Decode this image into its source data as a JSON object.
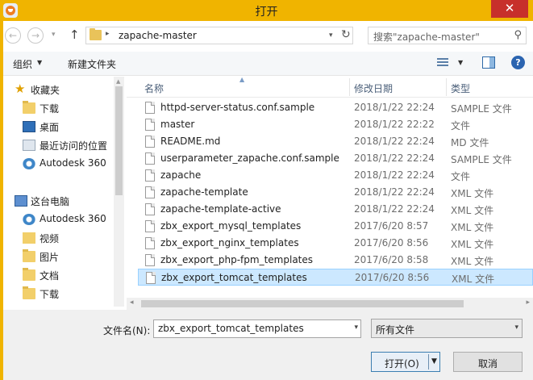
{
  "window": {
    "title": "打开",
    "close_glyph": "✕"
  },
  "nav": {
    "back_glyph": "←",
    "forward_glyph": "→",
    "recent_glyph": "▾",
    "up_glyph": "↑",
    "address": "zapache-master",
    "address_sep": "▸",
    "address_dd": "▾",
    "refresh_glyph": "↻",
    "search_placeholder": "搜索\"zapache-master\"",
    "search_glyph": "⚲"
  },
  "toolbar": {
    "organize": "组织",
    "organize_arrow": "▼",
    "new_folder": "新建文件夹",
    "view_arrow": "▼",
    "help": "?"
  },
  "sidebar": {
    "items": [
      {
        "label": "收藏夹",
        "icon": "star-icon"
      },
      {
        "label": "下载",
        "icon": "folder-icon"
      },
      {
        "label": "桌面",
        "icon": "desktop-icon"
      },
      {
        "label": "最近访问的位置",
        "icon": "recent-places-icon"
      },
      {
        "label": "Autodesk 360",
        "icon": "cloud-icon"
      },
      {
        "label": "这台电脑",
        "icon": "computer-icon"
      },
      {
        "label": "Autodesk 360",
        "icon": "cloud-icon"
      },
      {
        "label": "视频",
        "icon": "video-folder-icon"
      },
      {
        "label": "图片",
        "icon": "pictures-folder-icon"
      },
      {
        "label": "文档",
        "icon": "documents-folder-icon"
      },
      {
        "label": "下载",
        "icon": "downloads-folder-icon"
      }
    ],
    "scroll_up": "▲"
  },
  "filelist": {
    "columns": {
      "name": "名称",
      "modified": "修改日期",
      "type": "类型"
    },
    "sort_glyph": "▲",
    "rows": [
      {
        "name": "httpd-server-status.conf.sample",
        "date": "2018/1/22 22:24",
        "type": "SAMPLE 文件"
      },
      {
        "name": "master",
        "date": "2018/1/22 22:22",
        "type": "文件"
      },
      {
        "name": "README.md",
        "date": "2018/1/22 22:24",
        "type": "MD 文件"
      },
      {
        "name": "userparameter_zapache.conf.sample",
        "date": "2018/1/22 22:24",
        "type": "SAMPLE 文件"
      },
      {
        "name": "zapache",
        "date": "2018/1/22 22:24",
        "type": "文件"
      },
      {
        "name": "zapache-template",
        "date": "2018/1/22 22:24",
        "type": "XML 文件"
      },
      {
        "name": "zapache-template-active",
        "date": "2018/1/22 22:24",
        "type": "XML 文件"
      },
      {
        "name": "zbx_export_mysql_templates",
        "date": "2017/6/20 8:57",
        "type": "XML 文件"
      },
      {
        "name": "zbx_export_nginx_templates",
        "date": "2017/6/20 8:56",
        "type": "XML 文件"
      },
      {
        "name": "zbx_export_php-fpm_templates",
        "date": "2017/6/20 8:58",
        "type": "XML 文件"
      },
      {
        "name": "zbx_export_tomcat_templates",
        "date": "2017/6/20 8:56",
        "type": "XML 文件"
      }
    ],
    "selected_index": 10,
    "scroll_left": "◂",
    "scroll_right": "▸"
  },
  "bottom": {
    "filename_label": "文件名(N):",
    "filename_value": "zbx_export_tomcat_templates",
    "filename_dd": "▾",
    "filetype_value": "所有文件",
    "filetype_dd": "▾",
    "open_label": "打开(O)",
    "open_dd": "▼",
    "cancel_label": "取消"
  }
}
